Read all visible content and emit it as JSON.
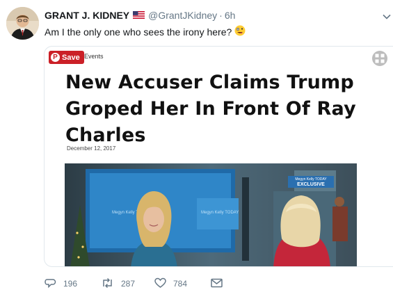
{
  "tweet": {
    "author_name": "GRANT J. KIDNEY",
    "handle": "@GrantJKidney",
    "separator": "·",
    "time": "6h",
    "text": "Am I the only one who sees the irony here?"
  },
  "card": {
    "save_label": "Save",
    "pinterest_glyph": "P",
    "category": "t Events",
    "headline": "New Accuser Claims Trump Groped Her In Front Of Ray Charles",
    "date": "December 12, 2017",
    "video_badge_line1": "Megyn Kelly TODAY",
    "video_badge_line2": "EXCLUSIVE",
    "wall_text": "Megyn Kelly TODAY"
  },
  "actions": {
    "replies": "196",
    "retweets": "287",
    "likes": "784"
  },
  "icons": {
    "flag": "us-flag-icon",
    "emoji": "zany-face-emoji-icon",
    "caret": "chevron-down-icon",
    "expand": "expand-icon",
    "reply": "reply-icon",
    "retweet": "retweet-icon",
    "like": "heart-icon",
    "dm": "envelope-icon"
  },
  "colors": {
    "pinterest_red": "#cb2027",
    "secondary_text": "#657786",
    "badge_blue": "#2a6fb0",
    "dress_blue": "#2a6f92"
  }
}
